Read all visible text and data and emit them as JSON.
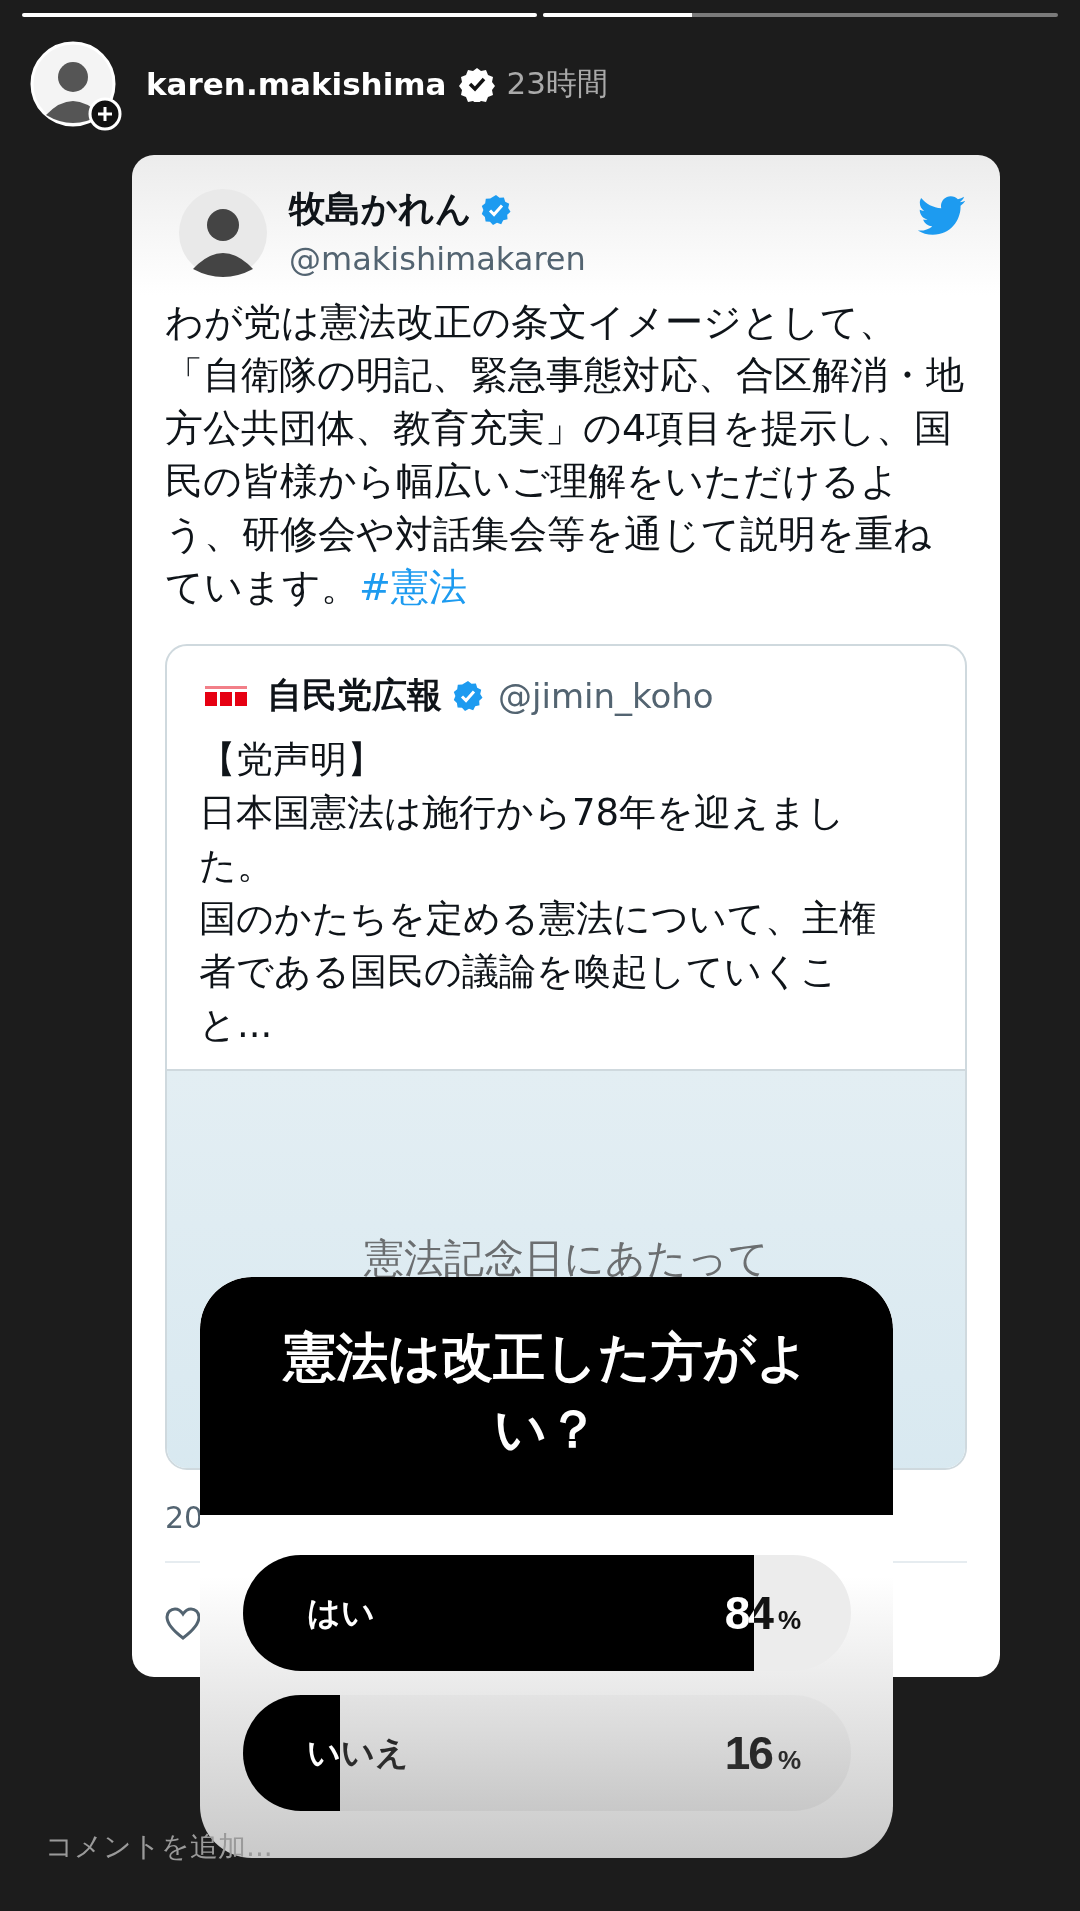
{
  "story": {
    "progress": [
      {
        "level": 1
      },
      {
        "level": 0.29
      }
    ],
    "user": {
      "username": "karen.makishima",
      "verified": true,
      "time": "23時間"
    }
  },
  "tweet": {
    "name": "牧島かれん",
    "verified": true,
    "handle": "@makishimakaren",
    "text": "わが党は憲法改正の条文イメージとして、「自衛隊の明記、緊急事態対応、合区解消・地方公共団体、教育充実」の4項目を提示し、国民の皆様から幅広いご理解をいただけるよう、研修会や対話集会等を通じて説明を重ねています。",
    "hashtag": "#憲法",
    "quote": {
      "name": "自民党広報",
      "verified": true,
      "handle": "@jimin_koho",
      "paragraphs": [
        "【党声明】",
        "日本国憲法は施行から78年を迎えました。",
        "国のかたちを定める憲法について、主権者である国民の議論を喚起していくこと..."
      ],
      "image_title": "憲法記念日にあたって"
    },
    "date": "20"
  },
  "poll": {
    "question": "憲法は改正した方がよい？",
    "options": [
      {
        "label": "はい",
        "level": 0.84,
        "value": "84",
        "unit": "%"
      },
      {
        "label": "いいえ",
        "level": 0.16,
        "value": "16",
        "unit": "%"
      }
    ]
  },
  "comment": {
    "placeholder": "コメントを追加..."
  }
}
